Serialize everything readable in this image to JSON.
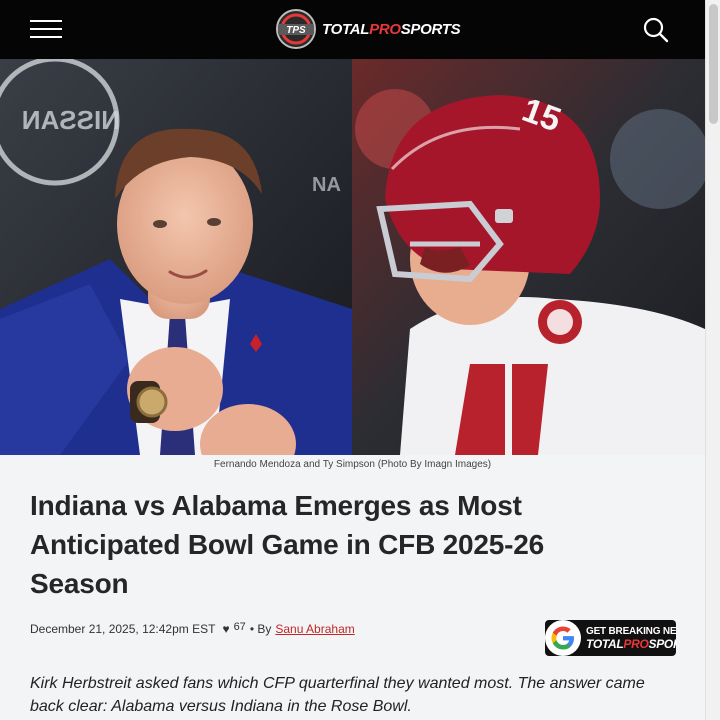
{
  "header": {
    "logo": {
      "mark": "TPS",
      "word_1": "TOTAL",
      "word_2": "PRO",
      "word_3": "SPORTS"
    },
    "icons": {
      "menu": "hamburger-menu-icon",
      "search": "search-icon"
    },
    "colors": {
      "bar": "#050505",
      "accent": "#e63838"
    }
  },
  "hero": {
    "left_photo": {
      "subject": "Fernando Mendoza"
    },
    "right_photo": {
      "subject": "Ty Simpson",
      "jersey_number": "15"
    }
  },
  "article": {
    "caption": "Fernando Mendoza and Ty Simpson (Photo By Imagn Images)",
    "headline": "Indiana vs Alabama Emerges as Most Anticipated Bowl Game in CFB 2025-26 Season",
    "date": "December 21, 2025, 12:42pm EST",
    "likes": "67",
    "by_label": "• By",
    "author": "Sanu Abraham",
    "lede": "Kirk Herbstreit asked fans which CFP quarterfinal they wanted most. The answer came back clear: Alabama versus Indiana in the Rose Bowl."
  },
  "badge": {
    "line_1": "GET BREAKING NEWS",
    "line_2a": "TOTAL",
    "line_2b": "PRO",
    "line_2c": "SPORTS",
    "icon": "google-g-icon"
  }
}
